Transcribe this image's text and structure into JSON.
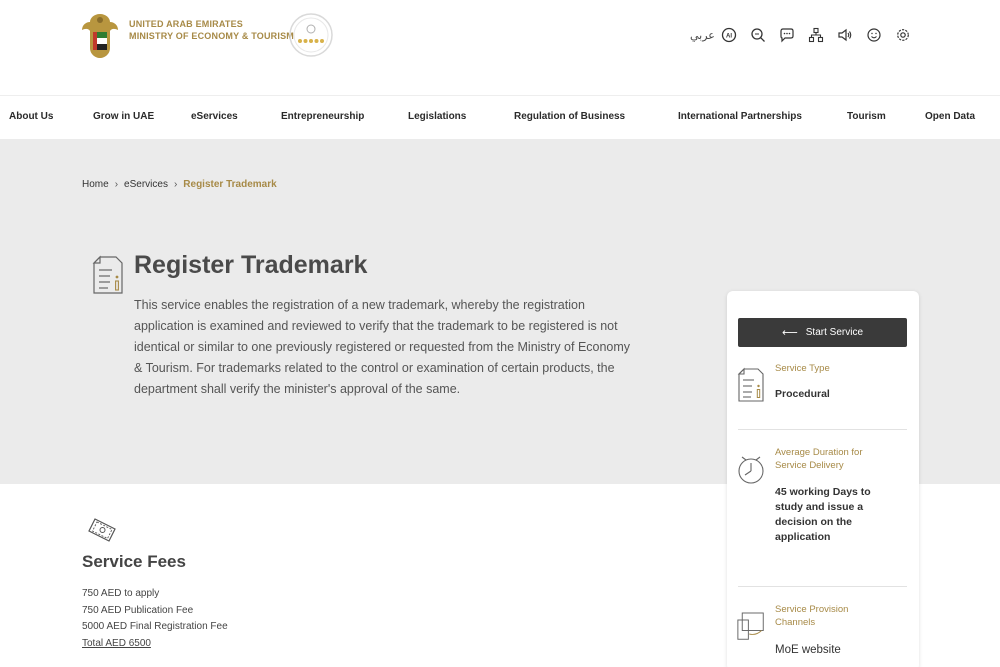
{
  "header": {
    "logo_line1": "UNITED ARAB EMIRATES",
    "logo_line2": "MINISTRY OF ECONOMY & TOURISM",
    "arabic_label": "عربي",
    "utility_icons": [
      "ai-assist-icon",
      "search-icon",
      "chat-icon",
      "sitemap-icon",
      "sound-icon",
      "happiness-icon",
      "settings-icon"
    ]
  },
  "nav": {
    "items": [
      {
        "label": "About Us"
      },
      {
        "label": "Grow in UAE"
      },
      {
        "label": "eServices"
      },
      {
        "label": "Entrepreneurship"
      },
      {
        "label": "Legislations"
      },
      {
        "label": "Regulation of Business"
      },
      {
        "label": "International Partnerships"
      },
      {
        "label": "Tourism"
      },
      {
        "label": "Open Data"
      }
    ]
  },
  "breadcrumb": {
    "home": "Home",
    "section": "eServices",
    "current": "Register Trademark"
  },
  "service": {
    "title": "Register Trademark",
    "description": "This service enables the registration of a new trademark, whereby the registration application is examined and reviewed to verify that the trademark to be registered is not identical or similar to one previously registered or requested from the Ministry of Economy & Tourism. For trademarks related to the control or examination of certain products, the department shall verify the minister's approval of the same."
  },
  "side_card": {
    "start_button": "Start Service",
    "type_label": "Service Type",
    "type_value": "Procedural",
    "duration_label": "Average Duration for Service Delivery",
    "duration_value": "45 working  Days  to study and issue a decision on the application",
    "channels_label": "Service Provision Channels",
    "channels_value": "MoE website"
  },
  "fees": {
    "title": "Service Fees",
    "lines": [
      "750 AED to apply",
      "750 AED Publication Fee",
      "5000 AED Final Registration Fee"
    ],
    "total": "Total AED 6500"
  },
  "colors": {
    "accent_gold": "#a78a47",
    "button_dark": "#3a3a3a",
    "hero_bg": "#ebebeb"
  }
}
